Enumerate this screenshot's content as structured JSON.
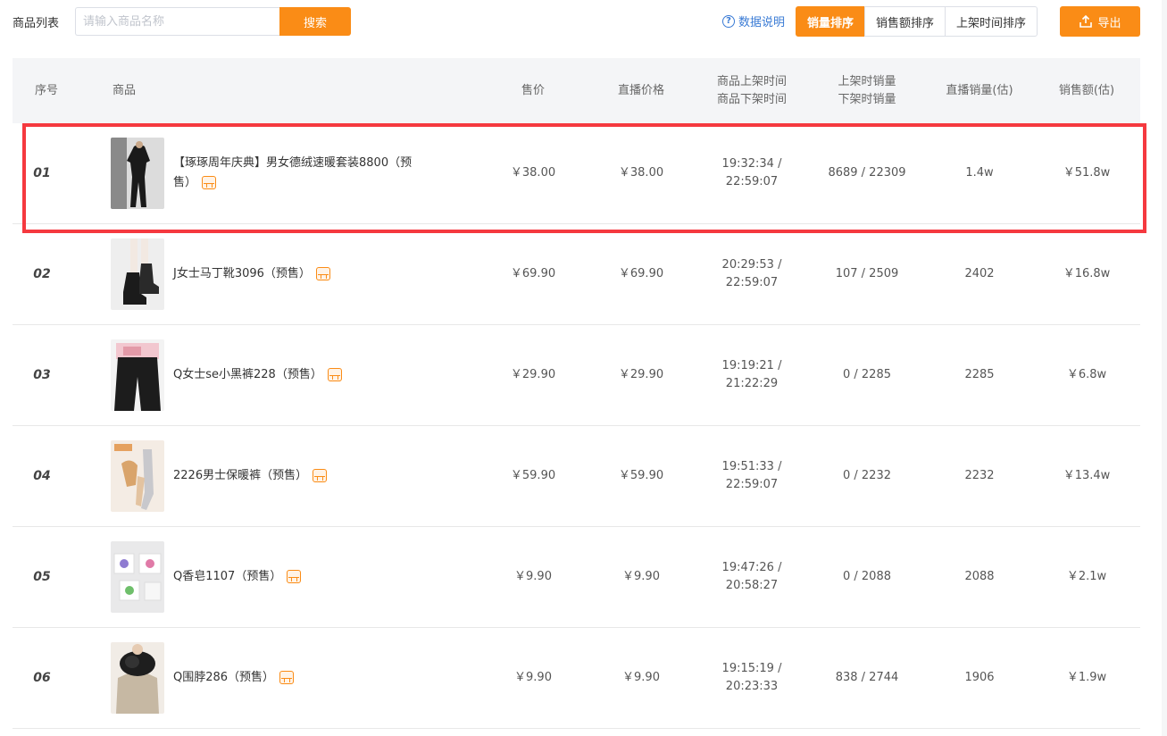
{
  "toolbar": {
    "title": "商品列表",
    "search_placeholder": "请输入商品名称",
    "search_label": "搜索",
    "help_label": "数据说明",
    "sort": [
      "销量排序",
      "销售额排序",
      "上架时间排序"
    ],
    "export_label": "导出"
  },
  "columns": {
    "index": "序号",
    "product": "商品",
    "price": "售价",
    "live_price": "直播价格",
    "time_1": "商品上架时间",
    "time_2": "商品下架时间",
    "sales_1": "上架时销量",
    "sales_2": "下架时销量",
    "live_sales": "直播销量(估)",
    "revenue": "销售额(估)"
  },
  "colors": {
    "accent": "#fa8c16",
    "highlight": "#f5393f",
    "link": "#3a7bd5"
  },
  "rows": [
    {
      "index": "01",
      "name": "【琢琢周年庆典】男女德绒速暖套装8800（预售）",
      "price": "￥38.00",
      "live_price": "￥38.00",
      "on_time": "19:32:34 /",
      "off_time": "22:59:07",
      "sales": "8689 / 22309",
      "live_sales": "1.4w",
      "revenue": "￥51.8w",
      "thumb": "dark-thermal-set"
    },
    {
      "index": "02",
      "name": "J女士马丁靴3096（预售）",
      "price": "￥69.90",
      "live_price": "￥69.90",
      "on_time": "20:29:53 /",
      "off_time": "22:59:07",
      "sales": "107 / 2509",
      "live_sales": "2402",
      "revenue": "￥16.8w",
      "thumb": "martin-boots"
    },
    {
      "index": "03",
      "name": "Q女士se小黑裤228（预售）",
      "price": "￥29.90",
      "live_price": "￥29.90",
      "on_time": "19:19:21 /",
      "off_time": "21:22:29",
      "sales": "0 / 2285",
      "live_sales": "2285",
      "revenue": "￥6.8w",
      "thumb": "black-pants"
    },
    {
      "index": "04",
      "name": "2226男士保暖裤（预售）",
      "price": "￥59.90",
      "live_price": "￥59.90",
      "on_time": "19:51:33 /",
      "off_time": "22:59:07",
      "sales": "0 / 2232",
      "live_sales": "2232",
      "revenue": "￥13.4w",
      "thumb": "warm-pants"
    },
    {
      "index": "05",
      "name": "Q香皂1107（预售）",
      "price": "￥9.90",
      "live_price": "￥9.90",
      "on_time": "19:47:26 /",
      "off_time": "20:58:27",
      "sales": "0 / 2088",
      "live_sales": "2088",
      "revenue": "￥2.1w",
      "thumb": "soap-boxes"
    },
    {
      "index": "06",
      "name": "Q围脖286（预售）",
      "price": "￥9.90",
      "live_price": "￥9.90",
      "on_time": "19:15:19 /",
      "off_time": "20:23:33",
      "sales": "838 / 2744",
      "live_sales": "1906",
      "revenue": "￥1.9w",
      "thumb": "fur-scarf"
    }
  ]
}
